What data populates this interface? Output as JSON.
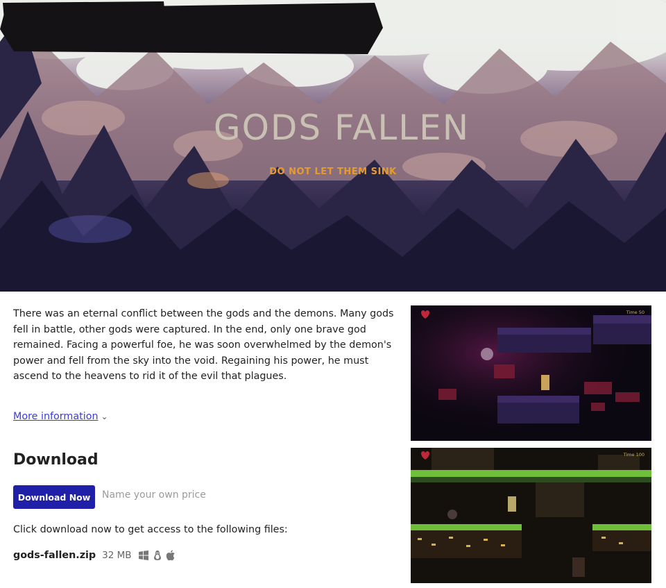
{
  "banner": {
    "title": "GODS FALLEN",
    "tagline": "DO NOT LET THEM SINK"
  },
  "description": "There was an eternal conflict between the gods and the demons. Many gods fell in battle, other gods were captured. In the end, only one brave god remained. Facing a powerful foe, he was soon overwhelmed by the demon's power and fell from the sky into the void. Regaining his power, he must ascend to the heavens to rid it of the evil that plagues.",
  "more_info": {
    "label": "More information",
    "icon": "chevron-down-icon"
  },
  "download": {
    "heading": "Download",
    "button_label": "Download Now",
    "price_placeholder": "Name your own price",
    "note": "Click download now to get access to the following files:",
    "file": {
      "name": "gods-fallen.zip",
      "size": "32 MB",
      "platforms": [
        "windows-icon",
        "linux-icon",
        "apple-icon"
      ]
    }
  },
  "screenshots": [
    {
      "hud_time": "Time 50"
    },
    {
      "hud_time": "Time 100"
    }
  ],
  "colors": {
    "button_bg": "#1f1fa8",
    "link": "#3b3bd9",
    "tagline": "#e69b2e"
  }
}
